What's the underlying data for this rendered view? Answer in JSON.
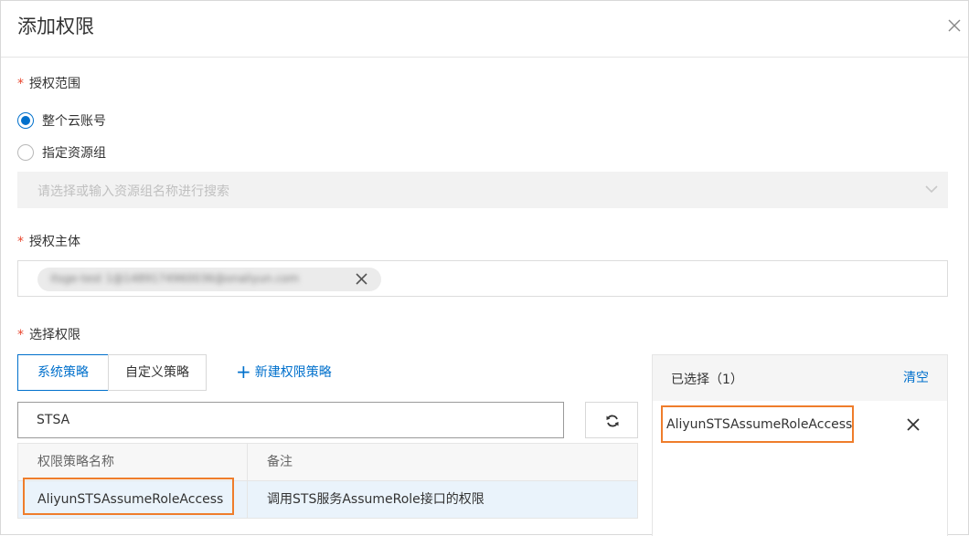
{
  "dialog": {
    "title": "添加权限",
    "close_icon": "close-icon"
  },
  "scope": {
    "label": "授权范围",
    "required_mark": "*",
    "options": [
      {
        "label": "整个云账号",
        "checked": true
      },
      {
        "label": "指定资源组",
        "checked": false
      }
    ],
    "resource_group_placeholder": "请选择或输入资源组名称进行搜索"
  },
  "principal": {
    "label": "授权主体",
    "required_mark": "*",
    "tag_value": "itsge-test 1@1489174960036@onaliyun.com"
  },
  "permissions": {
    "label": "选择权限",
    "required_mark": "*",
    "tabs": [
      {
        "label": "系统策略",
        "active": true
      },
      {
        "label": "自定义策略",
        "active": false
      }
    ],
    "new_policy_label": "新建权限策略",
    "search_value": "STSA",
    "table": {
      "columns": [
        "权限策略名称",
        "备注"
      ],
      "rows": [
        {
          "name": "AliyunSTSAssumeRoleAccess",
          "note": "调用STS服务AssumeRole接口的权限"
        }
      ]
    }
  },
  "selected": {
    "title": "已选择（1）",
    "clear_label": "清空",
    "items": [
      "AliyunSTSAssumeRoleAccess"
    ]
  },
  "colors": {
    "accent": "#0070cc",
    "required": "#e8462e",
    "highlight": "#ef7d2b"
  }
}
